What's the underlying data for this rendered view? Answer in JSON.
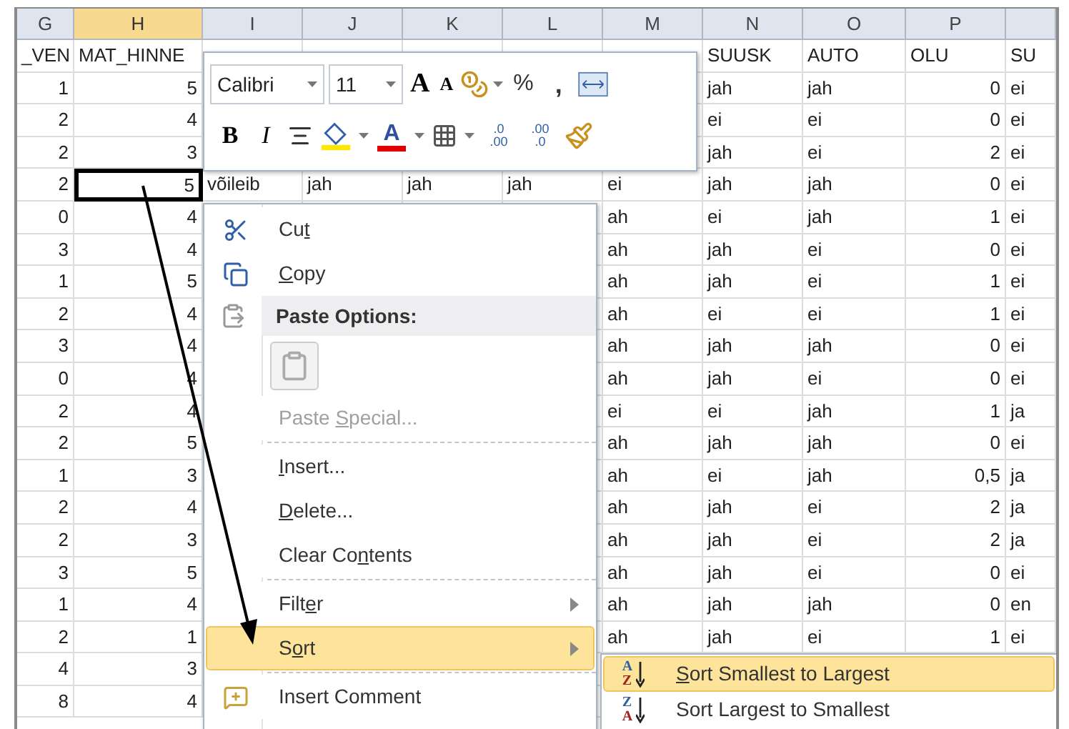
{
  "columns": [
    {
      "letter": "G",
      "numeric": true,
      "selected": false
    },
    {
      "letter": "H",
      "numeric": true,
      "selected": true
    },
    {
      "letter": "I",
      "numeric": false,
      "selected": false
    },
    {
      "letter": "J",
      "numeric": false,
      "selected": false
    },
    {
      "letter": "K",
      "numeric": false,
      "selected": false
    },
    {
      "letter": "L",
      "numeric": false,
      "selected": false
    },
    {
      "letter": "M",
      "numeric": false,
      "selected": false
    },
    {
      "letter": "N",
      "numeric": false,
      "selected": false
    },
    {
      "letter": "O",
      "numeric": false,
      "selected": false
    },
    {
      "letter": "P",
      "numeric": true,
      "selected": false
    },
    {
      "numeric": false,
      "selected": false
    }
  ],
  "rows": [
    {
      "selected": false,
      "cells": [
        "_VEN",
        "MAT_HINNE",
        null,
        null,
        null,
        null,
        null,
        "SUUSK",
        "AUTO",
        "OLU",
        "SU"
      ]
    },
    {
      "selected": false,
      "cells": [
        "1",
        "5",
        null,
        null,
        null,
        null,
        null,
        "jah",
        "jah",
        "0",
        "ei"
      ]
    },
    {
      "selected": false,
      "cells": [
        "2",
        "4",
        null,
        null,
        null,
        null,
        null,
        "ei",
        "ei",
        "0",
        "ei"
      ]
    },
    {
      "selected": false,
      "cells": [
        "2",
        "3",
        null,
        null,
        null,
        null,
        null,
        "jah",
        "ei",
        "2",
        "ei"
      ]
    },
    {
      "selected": true,
      "cells": [
        "2",
        "5",
        "võileib",
        "jah",
        "jah",
        "jah",
        "ei",
        "jah",
        "jah",
        "0",
        "ei"
      ]
    },
    {
      "selected": false,
      "cells": [
        "0",
        "4",
        null,
        null,
        null,
        null,
        "ah",
        "ei",
        "jah",
        "1",
        "ei"
      ]
    },
    {
      "selected": false,
      "cells": [
        "3",
        "4",
        null,
        null,
        null,
        null,
        "ah",
        "jah",
        "ei",
        "0",
        "ei"
      ]
    },
    {
      "selected": false,
      "cells": [
        "1",
        "5",
        null,
        null,
        null,
        null,
        "ah",
        "jah",
        "ei",
        "1",
        "ei"
      ]
    },
    {
      "selected": false,
      "cells": [
        "2",
        "4",
        null,
        null,
        null,
        null,
        "ah",
        "ei",
        "ei",
        "1",
        "ei"
      ]
    },
    {
      "selected": false,
      "cells": [
        "3",
        "4",
        null,
        null,
        null,
        null,
        "ah",
        "jah",
        "jah",
        "0",
        "ei"
      ]
    },
    {
      "selected": false,
      "cells": [
        "0",
        "4",
        null,
        null,
        null,
        null,
        "ah",
        "jah",
        "ei",
        "0",
        "ei"
      ]
    },
    {
      "selected": false,
      "cells": [
        "2",
        "4",
        null,
        null,
        null,
        null,
        "ei",
        "ei",
        "jah",
        "1",
        "ja"
      ]
    },
    {
      "selected": false,
      "cells": [
        "2",
        "5",
        null,
        null,
        null,
        null,
        "ah",
        "jah",
        "jah",
        "0",
        "ei"
      ]
    },
    {
      "selected": false,
      "cells": [
        "1",
        "3",
        null,
        null,
        null,
        null,
        "ah",
        "ei",
        "jah",
        "0,5",
        "ja"
      ]
    },
    {
      "selected": false,
      "cells": [
        "2",
        "4",
        null,
        null,
        null,
        null,
        "ah",
        "jah",
        "ei",
        "2",
        "ja"
      ]
    },
    {
      "selected": false,
      "cells": [
        "2",
        "3",
        null,
        null,
        null,
        null,
        "ah",
        "jah",
        "ei",
        "2",
        "ja"
      ]
    },
    {
      "selected": false,
      "cells": [
        "3",
        "5",
        null,
        null,
        null,
        null,
        "ah",
        "jah",
        "ei",
        "0",
        "ei"
      ]
    },
    {
      "selected": false,
      "cells": [
        "1",
        "4",
        null,
        null,
        null,
        null,
        "ah",
        "jah",
        "jah",
        "0",
        "en"
      ]
    },
    {
      "selected": false,
      "cells": [
        "2",
        "1",
        null,
        null,
        null,
        null,
        "ah",
        "jah",
        "ei",
        "1",
        "ei"
      ]
    },
    {
      "selected": false,
      "cells": [
        "4",
        "3",
        null,
        null,
        null,
        null,
        null,
        null,
        null,
        null,
        null
      ]
    },
    {
      "selected": false,
      "cells": [
        "8",
        "4",
        null,
        null,
        null,
        null,
        null,
        null,
        null,
        null,
        null
      ]
    }
  ],
  "mini_toolbar": {
    "font": "Calibri",
    "size": "11",
    "grow_label": "A",
    "shrink_label": "A",
    "percent": "%",
    "comma": ",",
    "bold": "B",
    "italic": "I",
    "font_color_label": "A",
    "increase_decimal": [
      ".0",
      ".00"
    ],
    "decrease_decimal": [
      ".00",
      ".0"
    ]
  },
  "context_menu": [
    {
      "kind": "command",
      "pre": "Cu",
      "key": "t",
      "disabled": false,
      "selected": false
    },
    {
      "kind": "command",
      "key": "C",
      "post": "opy",
      "disabled": false,
      "selected": false
    },
    {
      "kind": "header",
      "post": "Paste Options:"
    },
    {
      "kind": "paste_icon"
    },
    {
      "kind": "command",
      "pre": "Paste ",
      "key": "S",
      "post": "pecial...",
      "disabled": true,
      "selected": false
    },
    {
      "kind": "separator"
    },
    {
      "kind": "command",
      "key": "I",
      "post": "nsert...",
      "disabled": false,
      "selected": false
    },
    {
      "kind": "command",
      "key": "D",
      "post": "elete...",
      "disabled": false,
      "selected": false
    },
    {
      "kind": "command",
      "pre": "Clear Co",
      "key": "n",
      "post": "tents",
      "disabled": false,
      "selected": false
    },
    {
      "kind": "separator"
    },
    {
      "kind": "submenu",
      "pre": "Filt",
      "key": "e",
      "post": "r",
      "disabled": false,
      "selected": false
    },
    {
      "kind": "submenu",
      "pre": "S",
      "key": "o",
      "post": "rt",
      "disabled": false,
      "selected": true
    },
    {
      "kind": "separator"
    },
    {
      "kind": "command",
      "post": "Insert Comment",
      "disabled": false,
      "selected": false
    }
  ],
  "sort_submenu": [
    {
      "icon_letters": [
        "A",
        "Z"
      ],
      "key": "S",
      "post": "ort Smallest to Largest",
      "selected": true
    },
    {
      "icon_letters": [
        "Z",
        "A"
      ],
      "post": "Sort Largest to Smallest",
      "selected": false
    }
  ]
}
